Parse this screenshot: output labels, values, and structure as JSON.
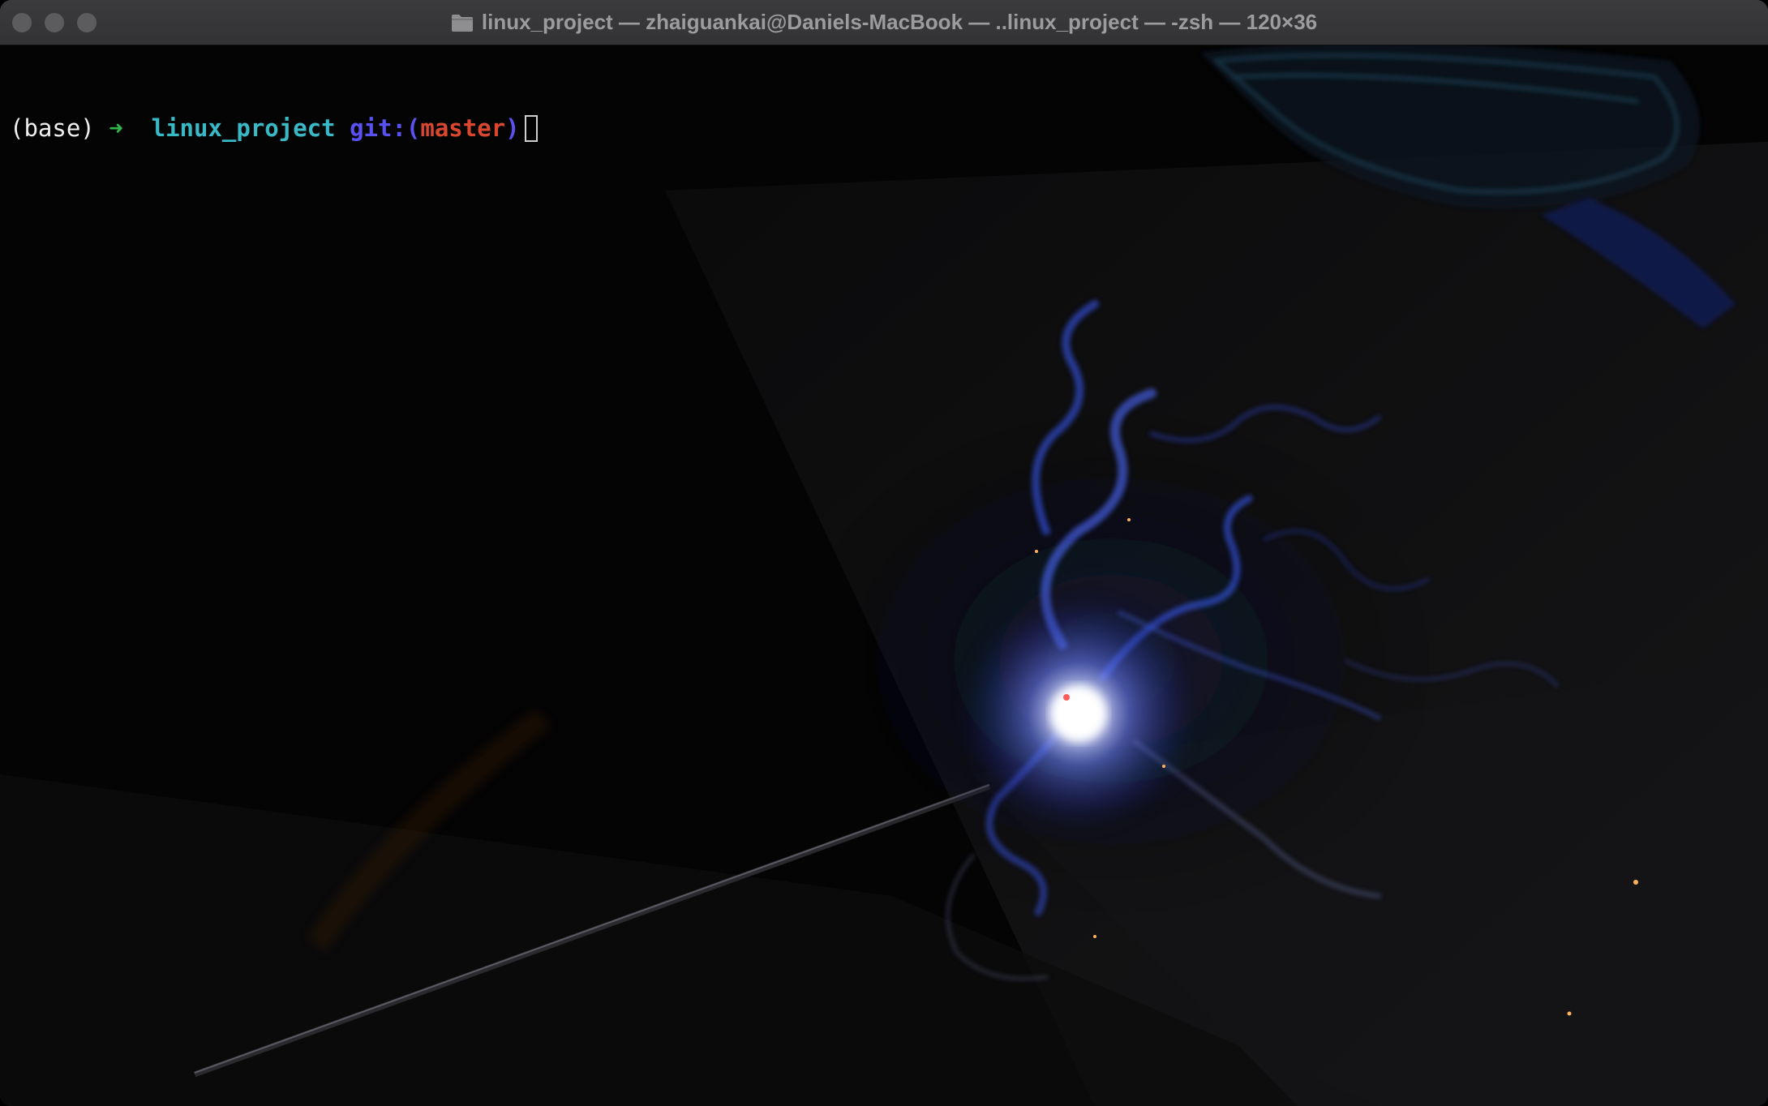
{
  "window": {
    "title": "linux_project — zhaiguankai@Daniels-MacBook — ..linux_project — -zsh — 120×36",
    "folder_icon": "folder-icon",
    "controls": [
      "close-button",
      "minimize-button",
      "zoom-button"
    ]
  },
  "terminal": {
    "prompt": {
      "env": "(base)",
      "arrow": "➜",
      "directory": "linux_project",
      "git_prefix": "git:(",
      "branch": "master",
      "git_suffix": ")"
    },
    "colors": {
      "env": "#f0f0f0",
      "arrow": "#2fb84a",
      "directory": "#39b9c6",
      "git": "#5a52f0",
      "branch": "#d9472f"
    }
  }
}
